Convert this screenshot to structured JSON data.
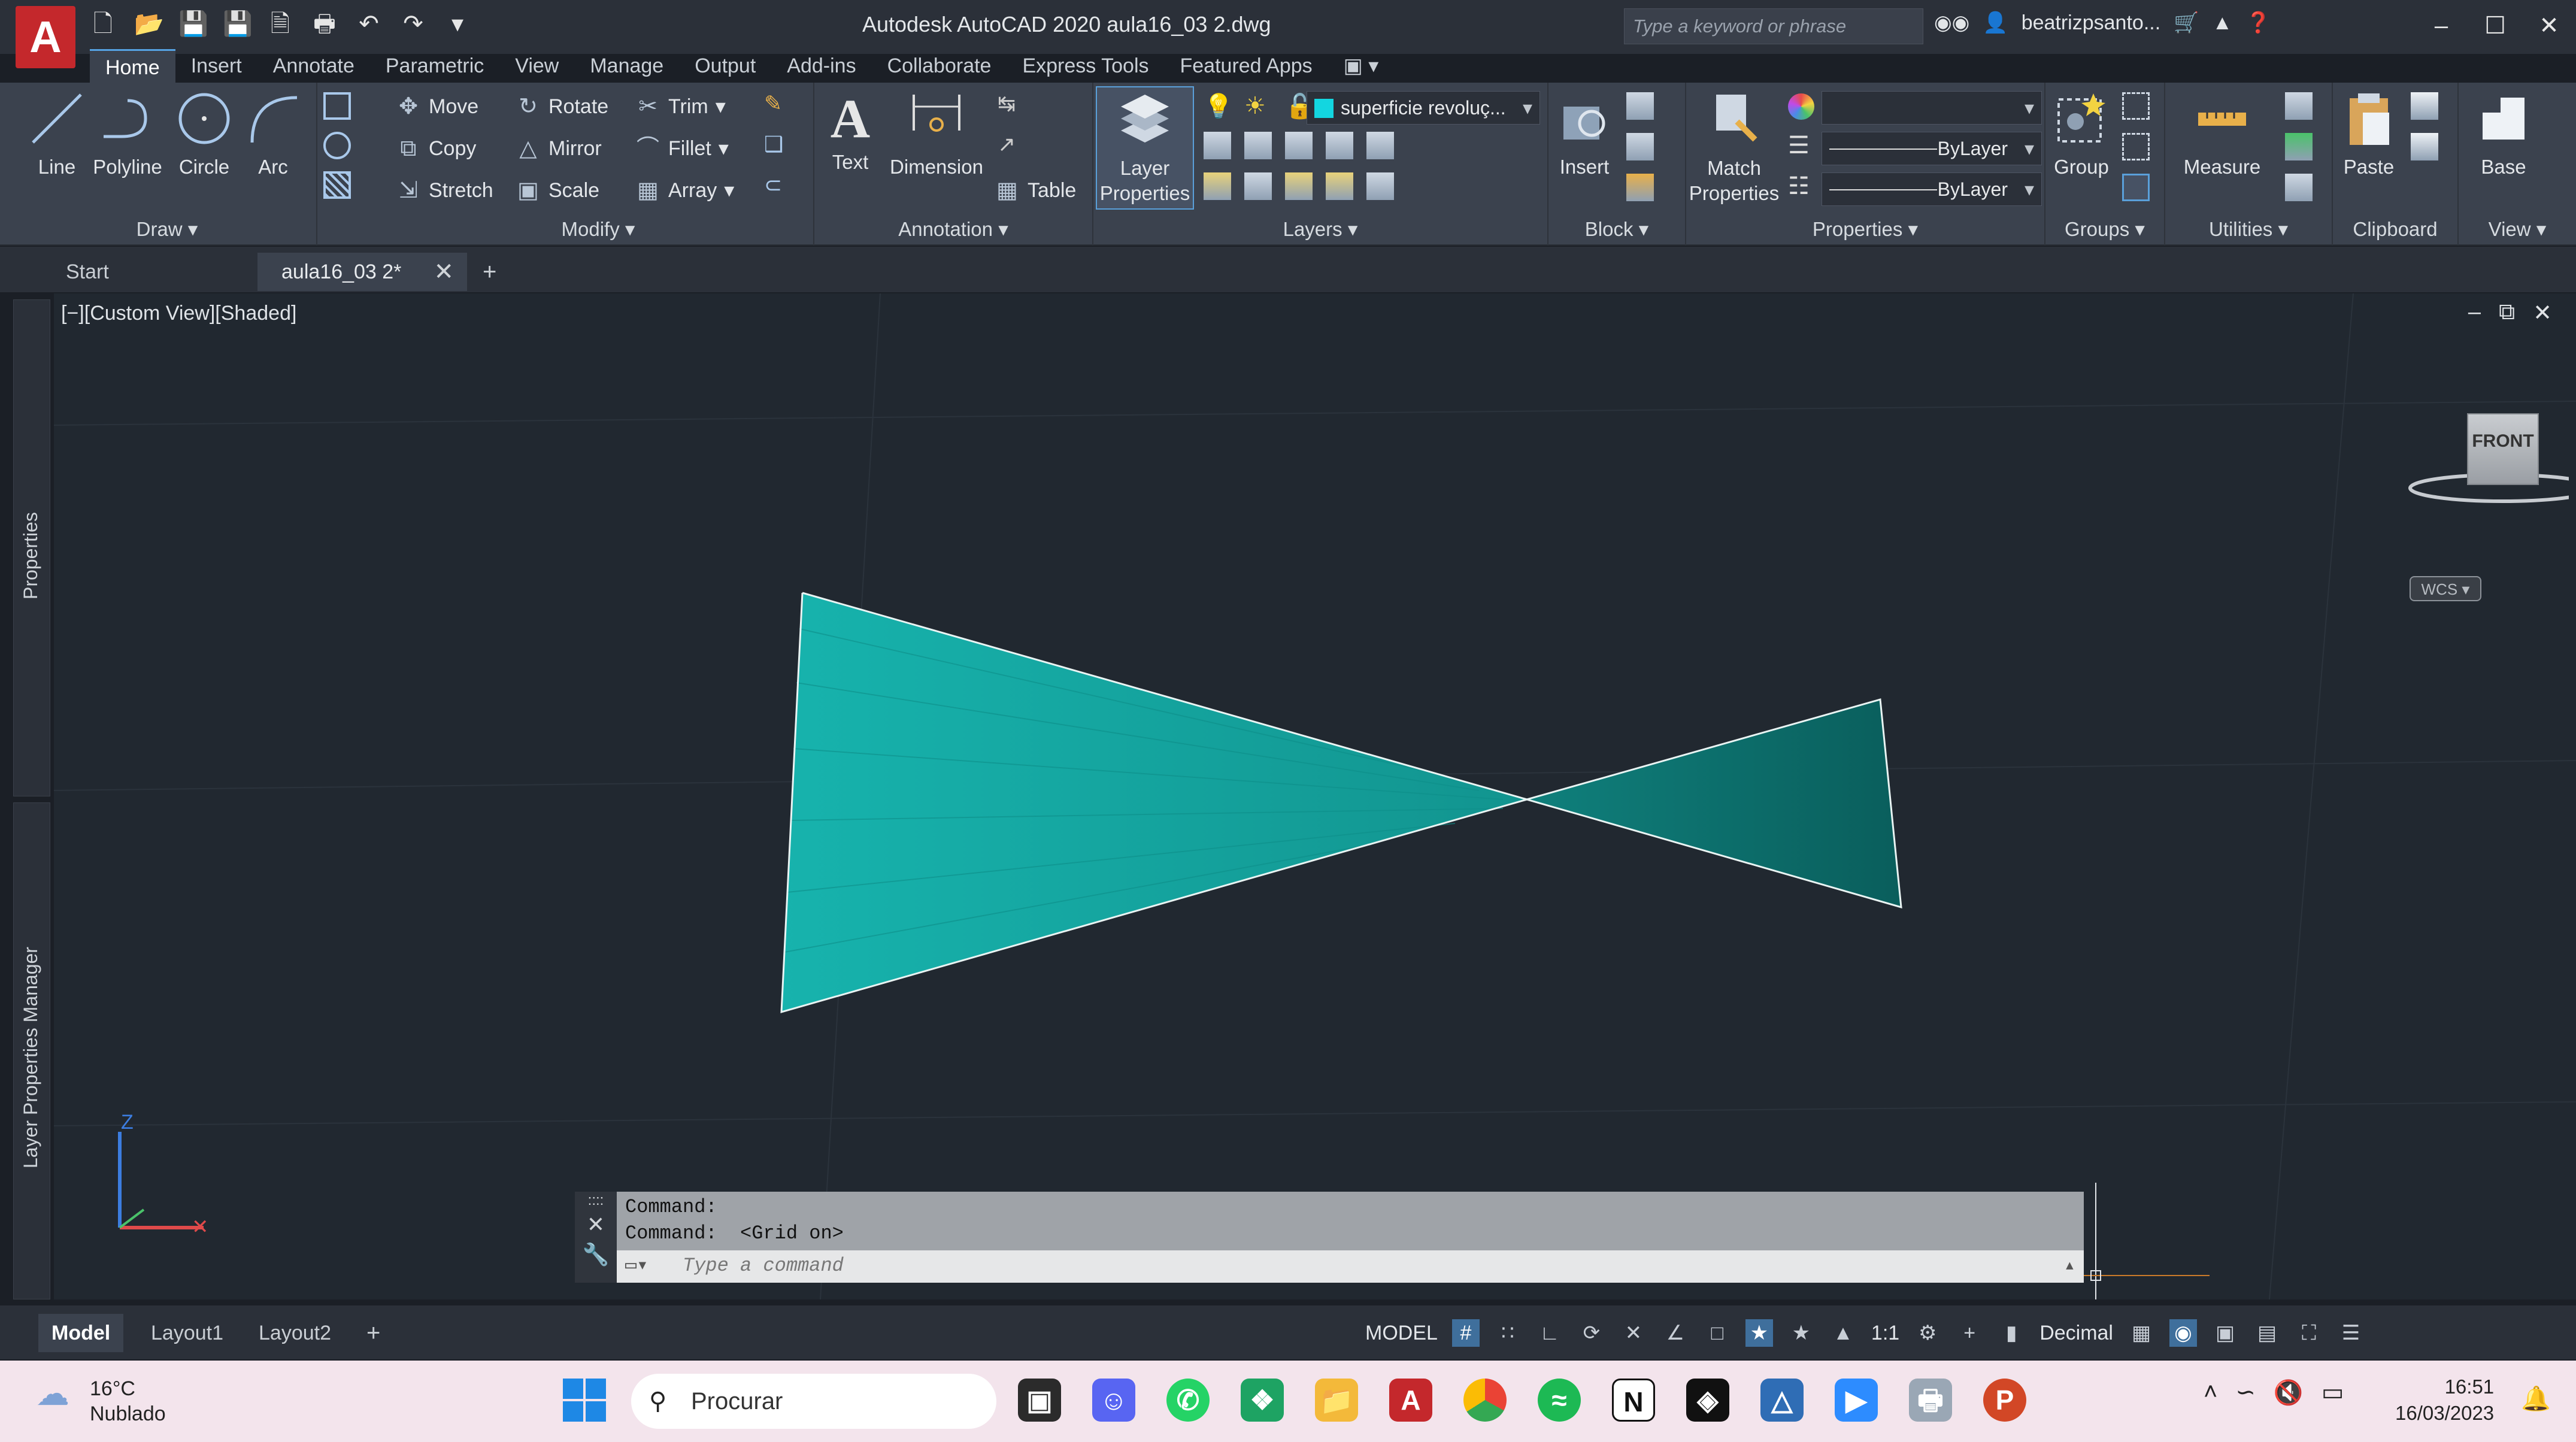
{
  "window": {
    "title": "Autodesk AutoCAD 2020    aula16_03 2.dwg",
    "search_placeholder": "Type a keyword or phrase",
    "user": "beatrizpsanto..."
  },
  "ribbon_tabs": [
    "Home",
    "Insert",
    "Annotate",
    "Parametric",
    "View",
    "Manage",
    "Output",
    "Add-ins",
    "Collaborate",
    "Express Tools",
    "Featured Apps"
  ],
  "panels": {
    "draw": {
      "title": "Draw",
      "line": "Line",
      "polyline": "Polyline",
      "circle": "Circle",
      "arc": "Arc"
    },
    "modify": {
      "title": "Modify",
      "move": "Move",
      "rotate": "Rotate",
      "trim": "Trim",
      "copy": "Copy",
      "mirror": "Mirror",
      "fillet": "Fillet",
      "stretch": "Stretch",
      "scale": "Scale",
      "array": "Array"
    },
    "annotation": {
      "title": "Annotation",
      "text": "Text",
      "dimension": "Dimension",
      "table": "Table"
    },
    "layers": {
      "title": "Layers",
      "layer_properties": "Layer Properties",
      "current_layer": "superficie revoluç..."
    },
    "block": {
      "title": "Block",
      "insert": "Insert"
    },
    "properties": {
      "title": "Properties",
      "match": "Match Properties",
      "linetype": "ByLayer",
      "lineweight": "ByLayer"
    },
    "groups": {
      "title": "Groups",
      "group": "Group"
    },
    "utilities": {
      "title": "Utilities",
      "measure": "Measure"
    },
    "clipboard": {
      "title": "Clipboard",
      "paste": "Paste"
    },
    "view": {
      "title": "View",
      "base": "Base"
    }
  },
  "doc_tabs": {
    "start": "Start",
    "active": "aula16_03 2*"
  },
  "side_palettes": {
    "properties": "Properties",
    "layer_manager": "Layer Properties Manager"
  },
  "viewport": {
    "label": "[−][Custom View][Shaded]",
    "viewcube_face": "FRONT",
    "wcs": "WCS",
    "fill_color": "#18a9a3",
    "ucs_z": "Z"
  },
  "command": {
    "line1": "Command:",
    "line2": "Command:  <Grid on>",
    "placeholder": "Type a command"
  },
  "layout_tabs": [
    "Model",
    "Layout1",
    "Layout2"
  ],
  "status": {
    "model": "MODEL",
    "scale": "1:1",
    "units": "Decimal"
  },
  "taskbar": {
    "temperature": "16°C",
    "weather": "Nublado",
    "search": "Procurar",
    "time": "16:51",
    "date": "16/03/2023"
  }
}
